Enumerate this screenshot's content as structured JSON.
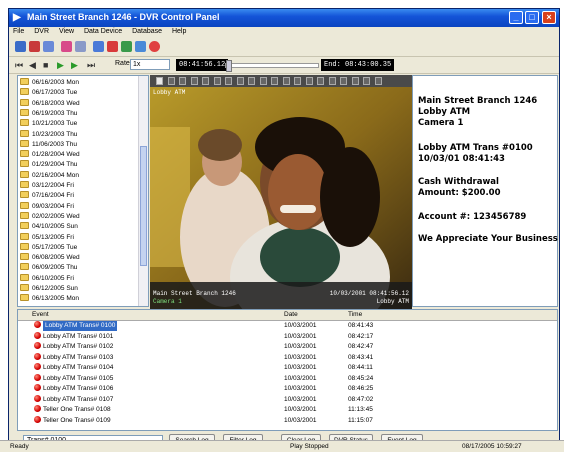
{
  "window": {
    "title": "Main Street Branch 1246  -  DVR Control Panel"
  },
  "menu": [
    "File",
    "DVR",
    "View",
    "Data Device",
    "Database",
    "Help"
  ],
  "playback": {
    "rate_label": "Rate:",
    "rate_value": "1x",
    "current_time": "08:41:56.12",
    "end_time": "End: 08:43:00.35",
    "position": 0.0
  },
  "file_list": [
    "06/16/2003 Mon",
    "06/17/2003 Tue",
    "06/18/2003 Wed",
    "06/19/2003 Thu",
    "10/21/2003 Tue",
    "10/23/2003 Thu",
    "11/06/2003 Thu",
    "01/28/2004 Wed",
    "01/29/2004 Thu",
    "02/16/2004 Mon",
    "03/12/2004 Fri",
    "07/16/2004 Fri",
    "09/03/2004 Fri",
    "02/02/2005 Wed",
    "04/10/2005 Sun",
    "05/13/2005 Fri",
    "05/17/2005 Tue",
    "06/08/2005 Wed",
    "06/09/2005 Thu",
    "06/10/2005 Fri",
    "06/12/2005 Sun",
    "06/13/2005 Mon"
  ],
  "video": {
    "overlay_title": "Lobby ATM",
    "bottom_left_line1": "Main Street Branch 1246",
    "bottom_left_line2": "Camera 1",
    "bottom_right_line1": "10/03/2001 08:41:56.12",
    "bottom_right_line2": "Lobby ATM"
  },
  "info_panel": {
    "line1": "Main Street Branch 1246",
    "line2": "Lobby ATM",
    "line3": "Camera 1",
    "line4": "Lobby ATM Trans #0100",
    "line5": "10/03/01     08:41:43",
    "line6": "Cash Withdrawal",
    "line7": "Amount:  $200.00",
    "line8": "Account #:  123456789",
    "line9": "We Appreciate Your Business"
  },
  "events": {
    "columns": {
      "event": "Event",
      "date": "Date",
      "time": "Time"
    },
    "rows": [
      {
        "event": "Lobby ATM Trans# 0100",
        "date": "10/03/2001",
        "time": "08:41:43"
      },
      {
        "event": "Lobby ATM Trans# 0101",
        "date": "10/03/2001",
        "time": "08:42:17"
      },
      {
        "event": "Lobby ATM Trans# 0102",
        "date": "10/03/2001",
        "time": "08:42:47"
      },
      {
        "event": "Lobby ATM Trans# 0103",
        "date": "10/03/2001",
        "time": "08:43:41"
      },
      {
        "event": "Lobby ATM Trans# 0104",
        "date": "10/03/2001",
        "time": "08:44:11"
      },
      {
        "event": "Lobby ATM Trans# 0105",
        "date": "10/03/2001",
        "time": "08:45:24"
      },
      {
        "event": "Lobby ATM Trans# 0106",
        "date": "10/03/2001",
        "time": "08:46:25"
      },
      {
        "event": "Lobby ATM Trans# 0107",
        "date": "10/03/2001",
        "time": "08:47:02"
      },
      {
        "event": "Teller One Trans# 0108",
        "date": "10/03/2001",
        "time": "11:13:45"
      },
      {
        "event": "Teller One Trans# 0109",
        "date": "10/03/2001",
        "time": "11:15:07"
      }
    ]
  },
  "bottom": {
    "search_value": "Trans# 0100",
    "buttons": [
      "Search Log",
      "Filter Log",
      "Clear Log",
      "DVR Status",
      "Event Log"
    ]
  },
  "status": {
    "left": "Ready",
    "center": "Play Stopped",
    "right": "08/17/2005 10:59:27"
  }
}
